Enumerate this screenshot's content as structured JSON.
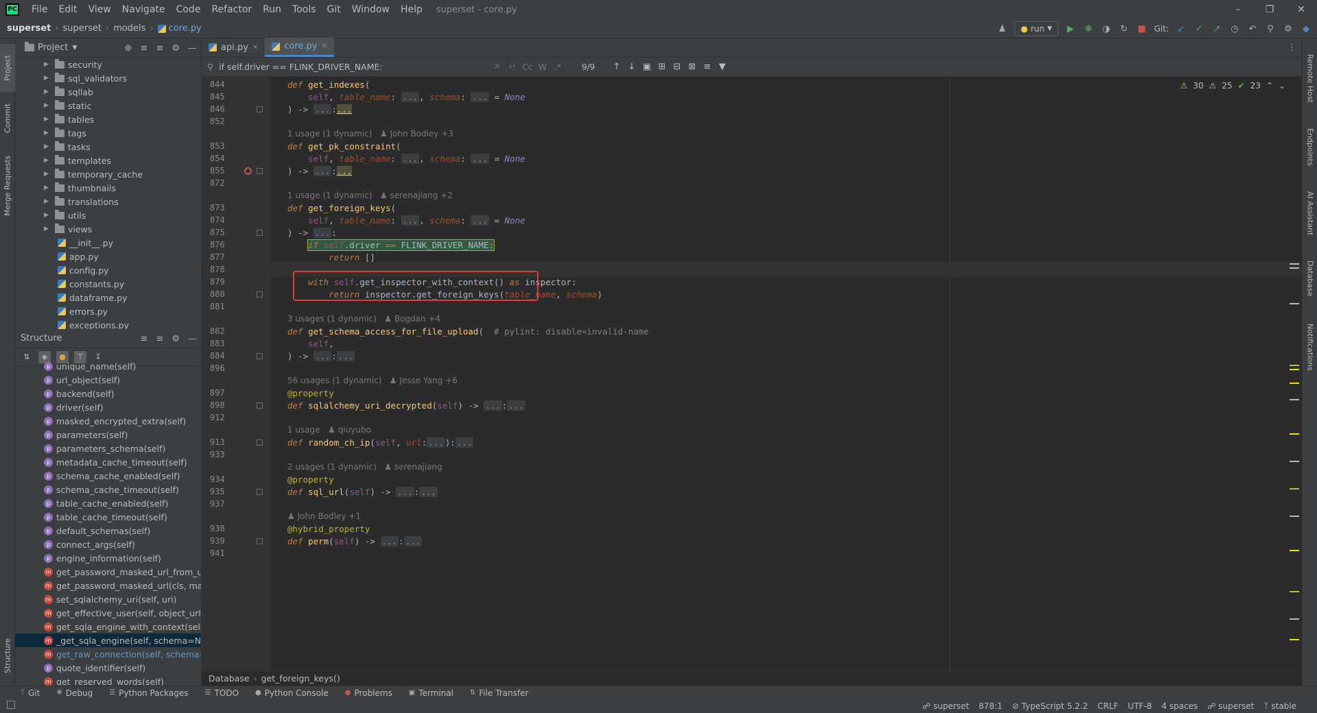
{
  "app": {
    "logo": "PC",
    "window_title": "superset - core.py",
    "menu": [
      "File",
      "Edit",
      "View",
      "Navigate",
      "Code",
      "Refactor",
      "Run",
      "Tools",
      "Git",
      "Window",
      "Help"
    ]
  },
  "navbar": {
    "breadcrumb": [
      "superset",
      "superset",
      "models",
      "core.py"
    ],
    "run_config": "run",
    "git_label": "Git:"
  },
  "left_strip": {
    "tabs": [
      "Project",
      "Commit",
      "Merge Requests",
      "Structure"
    ]
  },
  "right_strip": {
    "tabs": [
      "Remote Host",
      "Endpoints",
      "AI Assistant",
      "Database",
      "Notifications"
    ]
  },
  "project": {
    "title": "Project",
    "folders": [
      "security",
      "sql_validators",
      "sqllab",
      "static",
      "tables",
      "tags",
      "tasks",
      "templates",
      "temporary_cache",
      "thumbnails",
      "translations",
      "utils",
      "views"
    ],
    "files": [
      "__init__.py",
      "app.py",
      "config.py",
      "constants.py",
      "dataframe.py",
      "errors.py",
      "exceptions.py"
    ]
  },
  "structure": {
    "title": "Structure",
    "items": [
      {
        "badge": "p",
        "label": "unique_name(self)"
      },
      {
        "badge": "p",
        "label": "url_object(self)"
      },
      {
        "badge": "p",
        "label": "backend(self)"
      },
      {
        "badge": "p",
        "label": "driver(self)"
      },
      {
        "badge": "p",
        "label": "masked_encrypted_extra(self)"
      },
      {
        "badge": "p",
        "label": "parameters(self)"
      },
      {
        "badge": "p",
        "label": "parameters_schema(self)"
      },
      {
        "badge": "p",
        "label": "metadata_cache_timeout(self)"
      },
      {
        "badge": "p",
        "label": "schema_cache_enabled(self)"
      },
      {
        "badge": "p",
        "label": "schema_cache_timeout(self)"
      },
      {
        "badge": "p",
        "label": "table_cache_enabled(self)"
      },
      {
        "badge": "p",
        "label": "table_cache_timeout(self)"
      },
      {
        "badge": "p",
        "label": "default_schemas(self)"
      },
      {
        "badge": "p",
        "label": "connect_args(self)"
      },
      {
        "badge": "p",
        "label": "engine_information(self)"
      },
      {
        "badge": "m",
        "label": "get_password_masked_url_from_uri("
      },
      {
        "badge": "m",
        "label": "get_password_masked_url(cls, maske"
      },
      {
        "badge": "m",
        "label": "set_sqlalchemy_uri(self, uri)"
      },
      {
        "badge": "m",
        "label": "get_effective_user(self, object_url)"
      },
      {
        "badge": "m",
        "label": "get_sqla_engine_with_context(self, sc"
      },
      {
        "badge": "m",
        "label": "_get_sqla_engine(self, schema=None"
      },
      {
        "badge": "m",
        "label": "get_raw_connection(self, schema=No"
      },
      {
        "badge": "p",
        "label": "quote_identifier(self)"
      },
      {
        "badge": "m",
        "label": "get_reserved_words(self)"
      }
    ]
  },
  "tabs": [
    {
      "label": "api.py",
      "active": false
    },
    {
      "label": "core.py",
      "active": true
    }
  ],
  "find": {
    "query": "if self.driver == FLINK_DRIVER_NAME:",
    "count": "9/9",
    "options": [
      "Cc",
      "W",
      ".*"
    ]
  },
  "inspections": {
    "warn_a": "30",
    "warn_b": "25",
    "ok": "23"
  },
  "code": {
    "l844": "844",
    "l845": "845",
    "l846": "846",
    "l852": "852",
    "hint1": "1 usage (1 dynamic)",
    "hint1_author": "John Bodley +3",
    "l853": "853",
    "l854": "854",
    "l855": "855",
    "l872": "872",
    "hint2": "1 usage (1 dynamic)",
    "hint2_author": "serenajiang +2",
    "l873": "873",
    "l874": "874",
    "l875": "875",
    "l876": "876",
    "l877": "877",
    "l878": "878",
    "l879": "879",
    "l880": "880",
    "l881": "881",
    "hint3": "3 usages (1 dynamic)",
    "hint3_author": "Bogdan +4",
    "l882": "882",
    "l883": "883",
    "l884": "884",
    "l896": "896",
    "hint4": "56 usages (1 dynamic)",
    "hint4_author": "Jesse Yang +6",
    "l897": "897",
    "l898": "898",
    "l912": "912",
    "hint5": "1 usage",
    "hint5_author": "qiuyubo",
    "l913": "913",
    "l933": "933",
    "hint6": "2 usages (1 dynamic)",
    "hint6_author": "serenajiang",
    "l934": "934",
    "l935": "935",
    "l937": "937",
    "hint7_author": "John Bodley +1",
    "l938": "938",
    "l939": "939",
    "l941": "941"
  },
  "editor_breadcrumb": [
    "Database",
    "get_foreign_keys()"
  ],
  "tool_windows": [
    "Git",
    "Debug",
    "Python Packages",
    "TODO",
    "Python Console",
    "Problems",
    "Terminal",
    "File Transfer"
  ],
  "status": {
    "interpreter": "superset",
    "position": "878:1",
    "language": "TypeScript 5.2.2",
    "line_sep": "CRLF",
    "encoding": "UTF-8",
    "indent": "4 spaces",
    "project": "superset",
    "branch": "stable"
  }
}
